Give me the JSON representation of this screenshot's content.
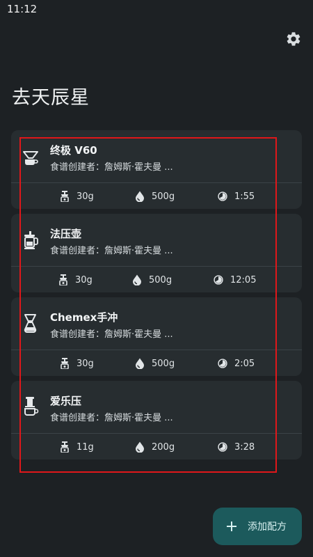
{
  "status_bar": {
    "time": "11:12"
  },
  "header": {
    "settings_icon": "gear-icon"
  },
  "page": {
    "title": "去天辰星"
  },
  "recipes": [
    {
      "icon": "pour-over-icon",
      "name": "终极 V60",
      "author": "食谱创建者：詹姆斯·霍夫曼 ...",
      "coffee": "30g",
      "water": "500g",
      "time": "1:55"
    },
    {
      "icon": "french-press-icon",
      "name": "法压壶",
      "author": "食谱创建者：詹姆斯·霍夫曼 ...",
      "coffee": "30g",
      "water": "500g",
      "time": "12:05"
    },
    {
      "icon": "chemex-icon",
      "name": "Chemex手冲",
      "author": "食谱创建者：詹姆斯·霍夫曼 ...",
      "coffee": "30g",
      "water": "500g",
      "time": "2:05"
    },
    {
      "icon": "aeropress-icon",
      "name": "爱乐压",
      "author": "食谱创建者：詹姆斯·霍夫曼 ...",
      "coffee": "11g",
      "water": "200g",
      "time": "3:28"
    }
  ],
  "fab": {
    "label": "添加配方"
  },
  "colors": {
    "background": "#1d2124",
    "card": "#272d30",
    "fab": "#1c5a5c",
    "highlight": "#e0171a"
  }
}
